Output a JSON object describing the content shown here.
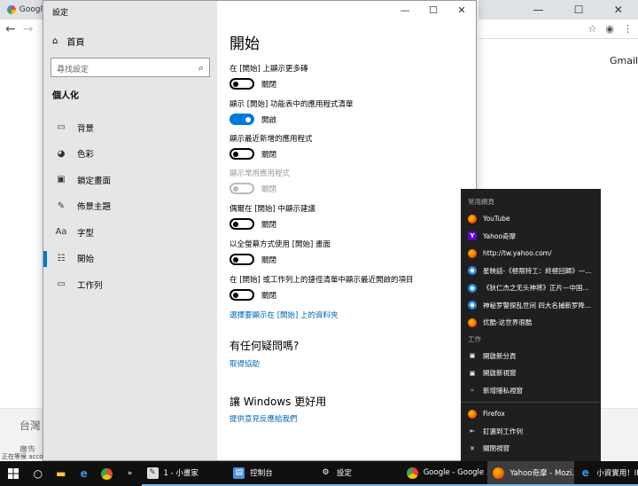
{
  "background_browser": {
    "tab_title": "Googl",
    "gmail_link": "Gmail",
    "footer_country": "台灣",
    "footer_link": "廣告",
    "status_text": "正在等候 acco"
  },
  "settings": {
    "window_title": "設定",
    "home_label": "首頁",
    "search_placeholder": "尋找設定",
    "category_title": "個人化",
    "nav_items": [
      {
        "label": "背景",
        "icon": "picture-icon"
      },
      {
        "label": "色彩",
        "icon": "palette-icon"
      },
      {
        "label": "鎖定畫面",
        "icon": "lock-screen-icon"
      },
      {
        "label": "佈景主題",
        "icon": "themes-icon"
      },
      {
        "label": "字型",
        "icon": "font-icon"
      },
      {
        "label": "開始",
        "icon": "start-icon",
        "active": true
      },
      {
        "label": "工作列",
        "icon": "taskbar-icon"
      }
    ],
    "page_title": "開始",
    "options": [
      {
        "label": "在 [開始] 上顯示更多磚",
        "state_label": "關閉",
        "on": false,
        "enabled": true
      },
      {
        "label": "顯示 [開始] 功能表中的應用程式清單",
        "state_label": "開啟",
        "on": true,
        "enabled": true
      },
      {
        "label": "顯示最近新增的應用程式",
        "state_label": "關閉",
        "on": false,
        "enabled": true
      },
      {
        "label": "顯示常用應用程式",
        "state_label": "關閉",
        "on": false,
        "enabled": false
      },
      {
        "label": "偶爾在 [開始] 中顯示建議",
        "state_label": "關閉",
        "on": false,
        "enabled": true
      },
      {
        "label": "以全螢幕方式使用 [開始] 畫面",
        "state_label": "關閉",
        "on": false,
        "enabled": true
      },
      {
        "label": "在 [開始] 或工作列上的捷徑清單中顯示最近開啟的項目",
        "state_label": "關閉",
        "on": false,
        "enabled": true
      }
    ],
    "folders_link": "選擇要顯示在 [開始] 上的資料夾",
    "question_heading": "有任何疑問嗎?",
    "help_link": "取得協助",
    "improve_heading": "讓 Windows 更好用",
    "feedback_link": "提供意見反應給我們"
  },
  "jumplist": {
    "frequent_heading": "常用網頁",
    "frequent_items": [
      {
        "label": "YouTube",
        "icon": "firefox-icon"
      },
      {
        "label": "Yahoo奇摩",
        "icon": "yahoo-icon"
      },
      {
        "label": "http://tw.yahoo.com/",
        "icon": "firefox-icon"
      },
      {
        "label": "星映話-《極限特工：終極回歸》—...",
        "icon": "web-icon"
      },
      {
        "label": "《狄仁杰之无头神将》正片—中国...",
        "icon": "web-icon"
      },
      {
        "label": "神秘罗警探乱世间 四大名捕新罗降...",
        "icon": "web-icon"
      },
      {
        "label": "优酷-这世界很酷",
        "icon": "firefox-icon"
      }
    ],
    "tasks_heading": "工作",
    "task_items": [
      {
        "label": "開啟新分頁",
        "icon": "new-tab-icon"
      },
      {
        "label": "開啟新視窗",
        "icon": "new-window-icon"
      },
      {
        "label": "新增隱私視窗",
        "icon": "private-window-icon"
      }
    ],
    "app_items": [
      {
        "label": "Firefox",
        "icon": "firefox-icon"
      },
      {
        "label": "釘選到工作列",
        "icon": "pin-icon"
      },
      {
        "label": "關閉視窗",
        "icon": "close-icon"
      }
    ]
  },
  "taskbar": {
    "buttons": [
      {
        "label": "1 - 小畫家",
        "icon": "paint-icon"
      },
      {
        "label": "控制台",
        "icon": "control-panel-icon"
      },
      {
        "label": "設定",
        "icon": "settings-icon"
      },
      {
        "label": "Google - Google ...",
        "icon": "chrome-icon"
      },
      {
        "label": "Yahoo奇摩 - Mozi...",
        "icon": "firefox-icon"
      },
      {
        "label": "小資實用！IKE...",
        "icon": "edge-icon"
      }
    ]
  }
}
